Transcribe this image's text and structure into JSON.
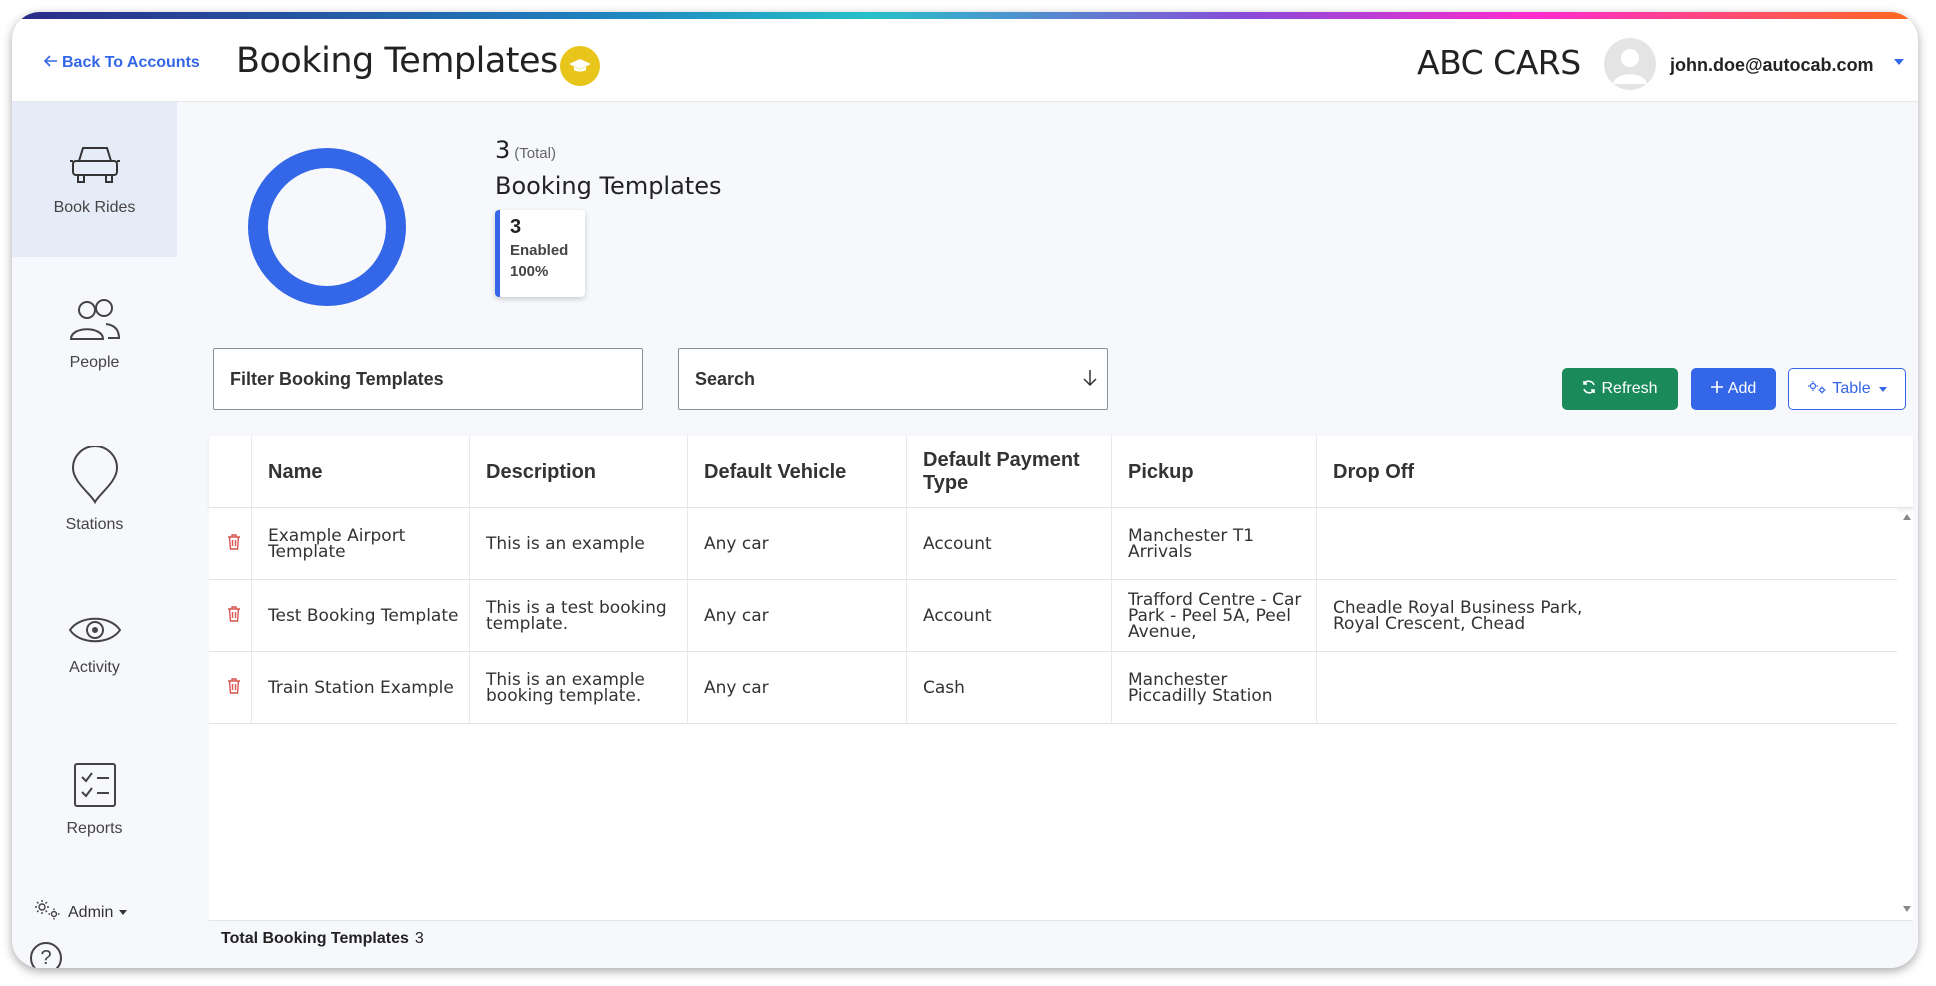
{
  "header": {
    "back_label": "Back To Accounts",
    "title": "Booking Templates",
    "company": "ABC CARS",
    "user_email": "john.doe@autocab.com"
  },
  "sidebar": {
    "items": [
      {
        "label": "Book Rides",
        "icon": "car-icon",
        "active": true
      },
      {
        "label": "People",
        "icon": "people-icon"
      },
      {
        "label": "Stations",
        "icon": "map-pin-icon"
      },
      {
        "label": "Activity",
        "icon": "eye-icon"
      },
      {
        "label": "Reports",
        "icon": "checklist-icon"
      }
    ],
    "admin_label": "Admin",
    "help_glyph": "?"
  },
  "summary": {
    "total": "3",
    "total_label": "(Total)",
    "title": "Booking Templates",
    "enabled_count": "3",
    "enabled_label": "Enabled",
    "enabled_pct": "100%",
    "enabled_fraction": 1.0
  },
  "controls": {
    "filter_label": "Filter Booking Templates",
    "search_label": "Search",
    "refresh_label": "Refresh",
    "add_label": "Add",
    "view_label": "Table"
  },
  "table": {
    "columns": [
      "Name",
      "Description",
      "Default Vehicle",
      "Default Payment Type",
      "Pickup",
      "Drop Off"
    ],
    "rows": [
      {
        "name": "Example Airport Template",
        "description": "This is an example",
        "vehicle": "Any car",
        "payment": "Account",
        "pickup": "Manchester T1 Arrivals",
        "dropoff": ""
      },
      {
        "name": "Test Booking Template",
        "description": "This is a test booking template.",
        "vehicle": "Any car",
        "payment": "Account",
        "pickup": "Trafford Centre - Car Park - Peel 5A, Peel Avenue,",
        "dropoff": "Cheadle Royal Business Park, Royal Crescent, Chead"
      },
      {
        "name": "Train Station Example",
        "description": "This is an example booking template.",
        "vehicle": "Any car",
        "payment": "Cash",
        "pickup": "Manchester Piccadilly Station",
        "dropoff": ""
      }
    ]
  },
  "footer": {
    "total_label": "Total Booking Templates",
    "total_value": "3"
  },
  "colors": {
    "accent": "#3466e8",
    "refresh": "#1b8a5a",
    "delete": "#d9534f",
    "badge": "#e8c51a"
  }
}
